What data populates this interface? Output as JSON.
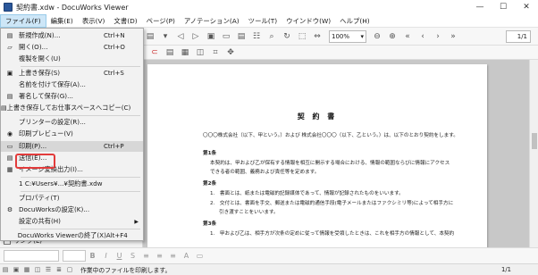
{
  "window": {
    "title": "契約書.xdw - DocuWorks Viewer",
    "minimize": "—",
    "maximize": "☐",
    "close": "✕"
  },
  "menubar": [
    "ファイル(F)",
    "編集(E)",
    "表示(V)",
    "文書(D)",
    "ページ(P)",
    "アノテーション(A)",
    "ツール(T)",
    "ウインドウ(W)",
    "ヘルプ(H)"
  ],
  "file_menu": [
    {
      "icon": "new-doc-icon",
      "glyph": "▤",
      "label": "新規作成(N)...",
      "shortcut": "Ctrl+N"
    },
    {
      "icon": "open-folder-icon",
      "glyph": "▱",
      "label": "開く(O)...",
      "shortcut": "Ctrl+O"
    },
    {
      "icon": "",
      "glyph": "",
      "label": "複製を開く(U)",
      "shortcut": ""
    },
    {
      "icon": "save-icon",
      "glyph": "▣",
      "label": "上書き保存(S)",
      "shortcut": "Ctrl+S"
    },
    {
      "icon": "",
      "glyph": "",
      "label": "名前を付けて保存(A)...",
      "shortcut": ""
    },
    {
      "icon": "signed-save-icon",
      "glyph": "▤",
      "label": "署名して保存(G)...",
      "shortcut": ""
    },
    {
      "icon": "workspace-save-icon",
      "glyph": "▤",
      "label": "上書き保存してお仕事スペースへコピー(C)",
      "shortcut": ""
    },
    {
      "icon": "",
      "glyph": "",
      "label": "プリンターの設定(R)...",
      "shortcut": ""
    },
    {
      "icon": "print-preview-icon",
      "glyph": "◉",
      "label": "印刷プレビュー(V)",
      "shortcut": ""
    },
    {
      "icon": "print-icon",
      "glyph": "▭",
      "label": "印刷(P)...",
      "shortcut": "Ctrl+P"
    },
    {
      "icon": "send-icon",
      "glyph": "▤",
      "label": "送信(E)...",
      "shortcut": ""
    },
    {
      "icon": "image-convert-icon",
      "glyph": "▦",
      "label": "イメージ変換出力(I)...",
      "shortcut": ""
    },
    {
      "icon": "",
      "glyph": "",
      "label": "1 C:¥Users¥...¥契約書.xdw",
      "shortcut": ""
    },
    {
      "icon": "",
      "glyph": "",
      "label": "プロパティ(T)",
      "shortcut": ""
    },
    {
      "icon": "settings-icon",
      "glyph": "⚙",
      "label": "DocuWorksの設定(K)...",
      "shortcut": ""
    },
    {
      "icon": "",
      "glyph": "",
      "label": "設定の共有(H)",
      "shortcut": "",
      "submenu": "▶"
    },
    {
      "icon": "",
      "glyph": "",
      "label": "DocuWorks Viewerの終了(X)",
      "shortcut": "Alt+F4"
    }
  ],
  "left_pane": {
    "link_label": "リンク(L)"
  },
  "toolbar": {
    "zoom": "100%",
    "page": "1/1"
  },
  "document": {
    "title": "契 約 書",
    "lines": [
      "〇〇〇株式会社（以下、甲という。）および 株式会社〇〇〇（以下、乙という。）は、以下のとおり契約をします。",
      "第1条",
      "本契約は、甲および乙が保有する情報を相互に開示する場合における、情報の範囲ならびに情報にアクセス",
      "できる者の範囲、義務および責任等を定めます。",
      "第2条",
      "1.　書面とは、紙または電磁的記録媒体であって、情報が記録されたものをいいます。",
      "2.　交付とは、書面を手交、郵送または電磁的通信手段(電子メールまたはファクシミリ等)によって相手方に",
      "引き渡すことをいいます。",
      "第3条",
      "1.　甲および乙は、相手方が次条の定めに従って情報を受領したときは、これを相手方の情報として、本契約"
    ]
  },
  "status": {
    "message": "作業中のファイルを印刷します。",
    "page": "1/1"
  },
  "colors": {
    "highlight_box": "#e23b3b",
    "menu_active": "#cde6f7"
  }
}
